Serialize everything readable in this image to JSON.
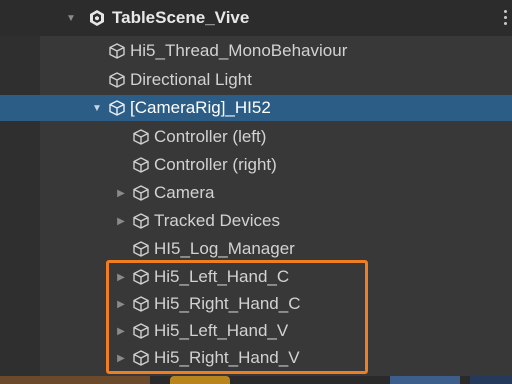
{
  "hierarchy": {
    "scene": {
      "name": "TableScene_Vive",
      "icon": "unity-scene-icon"
    },
    "items": [
      {
        "label": "Hi5_Thread_MonoBehaviour",
        "icon": "gameobject-cube-icon",
        "expandable": false
      },
      {
        "label": "Directional Light",
        "icon": "gameobject-cube-icon",
        "expandable": false
      },
      {
        "label": "[CameraRig]_HI52",
        "icon": "gameobject-cube-icon",
        "expandable": true,
        "expanded": true,
        "selected": true
      },
      {
        "label": "Controller (left)",
        "icon": "gameobject-cube-icon",
        "expandable": false
      },
      {
        "label": "Controller (right)",
        "icon": "gameobject-cube-icon",
        "expandable": false
      },
      {
        "label": "Camera",
        "icon": "gameobject-cube-icon",
        "expandable": true,
        "expanded": false
      },
      {
        "label": "Tracked Devices",
        "icon": "gameobject-cube-icon",
        "expandable": true,
        "expanded": false
      },
      {
        "label": "HI5_Log_Manager",
        "icon": "gameobject-cube-icon",
        "expandable": false
      },
      {
        "label": "Hi5_Left_Hand_C",
        "icon": "gameobject-cube-icon",
        "expandable": true,
        "expanded": false
      },
      {
        "label": "Hi5_Right_Hand_C",
        "icon": "gameobject-cube-icon",
        "expandable": true,
        "expanded": false
      },
      {
        "label": "Hi5_Left_Hand_V",
        "icon": "gameobject-cube-icon",
        "expandable": true,
        "expanded": false
      },
      {
        "label": "Hi5_Right_Hand_V",
        "icon": "gameobject-cube-icon",
        "expandable": true,
        "expanded": false
      }
    ]
  },
  "colors": {
    "background": "#383838",
    "selection": "#2c5d87",
    "highlight_box": "#ef7d22",
    "text": "#d2d2d2"
  }
}
